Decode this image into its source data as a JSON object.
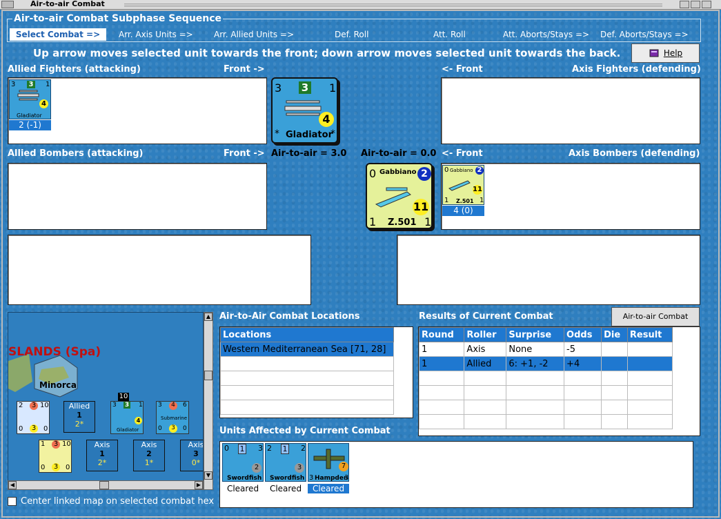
{
  "window": {
    "title": "Air-to-air Combat"
  },
  "sequence": {
    "title": "Air-to-air Combat Subphase Sequence",
    "steps": [
      "Select Combat =>",
      "Arr. Axis Units =>",
      "Arr. Allied Units =>",
      "Def. Roll",
      "Att. Roll",
      "Att. Aborts/Stays =>",
      "Def. Aborts/Stays =>"
    ]
  },
  "instructions": "Up arrow moves selected unit towards the front; down arrow moves selected unit towards the back.",
  "help_label": "Help",
  "allied_fighters": {
    "label": "Allied Fighters (attacking)",
    "front": "Front ->",
    "unit": {
      "name": "Gladiator",
      "left": "3",
      "str": "3",
      "right": "1",
      "range": "4",
      "caption": "2 (-1)"
    }
  },
  "axis_fighters": {
    "label": "Axis Fighters (defending)",
    "front": "<- Front"
  },
  "big_allied": {
    "name": "Gladiator",
    "left": "3",
    "str": "3",
    "right": "1",
    "range": "4",
    "star_l": "*",
    "star_r": "*"
  },
  "allied_bombers": {
    "label": "Allied Bombers (attacking)",
    "front": "Front ->",
    "a2a": "Air-to-air = 3.0"
  },
  "axis_bombers": {
    "label": "Axis Bombers (defending)",
    "front": "<- Front",
    "a2a": "Air-to-air = 0.0",
    "unit": {
      "name": "Gabbiano",
      "type": "Z.501",
      "left": "0",
      "str": "2",
      "range": "11",
      "bl": "1",
      "br": "1",
      "caption": "4 (0)"
    }
  },
  "big_axis": {
    "name": "Gabbiano",
    "type": "Z.501",
    "left": "0",
    "str": "2",
    "range": "11",
    "bl": "1",
    "br": "1"
  },
  "map": {
    "region": "SLANDS (Spa)",
    "island": "Minorca",
    "stack_top": "10",
    "allied_label": "Allied",
    "allied_n": "1",
    "allied_sub": "2*",
    "ship1": {
      "a": "2",
      "b": "3",
      "c": "10",
      "d": "0",
      "e": "3",
      "f": "0"
    },
    "glad": {
      "a": "3",
      "b": "3",
      "c": "1",
      "d": "4",
      "name": "Gladiator"
    },
    "sub": {
      "a": "3",
      "b": "4",
      "c": "6",
      "d": "0",
      "e": "3",
      "f": "0",
      "name": "Submarine"
    },
    "ship2": {
      "a": "1",
      "b": "3",
      "c": "10",
      "d": "0",
      "e": "3",
      "f": "0"
    },
    "axis": [
      {
        "label": "Axis",
        "n": "1",
        "sub": "2*"
      },
      {
        "label": "Axis",
        "n": "2",
        "sub": "1*"
      },
      {
        "label": "Axis",
        "n": "3",
        "sub": "0*"
      }
    ]
  },
  "center_linked": "Center linked map on selected combat hex",
  "locations": {
    "title": "Air-to-Air Combat Locations",
    "header": "Locations",
    "rows": [
      "Western Mediterranean Sea [71, 28]"
    ]
  },
  "results": {
    "title": "Results of Current Combat",
    "chart_button": "Air-to-air Combat Chart",
    "headers": [
      "Round",
      "Roller",
      "Surprise",
      "Odds",
      "Die",
      "Result"
    ],
    "rows": [
      [
        "1",
        "Axis",
        "None",
        "-5",
        "",
        ""
      ],
      [
        "1",
        "Allied",
        "6: +1, -2",
        "+4",
        "",
        ""
      ]
    ]
  },
  "affected": {
    "title": "Units Affected by Current Combat",
    "units": [
      {
        "name": "Swordfish",
        "l": "0",
        "s": "1",
        "r": "3",
        "d": "2",
        "status": "Cleared"
      },
      {
        "name": "Swordfish",
        "l": "2",
        "s": "1",
        "r": "2",
        "d": "3",
        "status": "Cleared"
      },
      {
        "name": "Hampden",
        "l": "3",
        "s": "",
        "r": "3",
        "d": "7",
        "status": "Cleared"
      }
    ]
  }
}
